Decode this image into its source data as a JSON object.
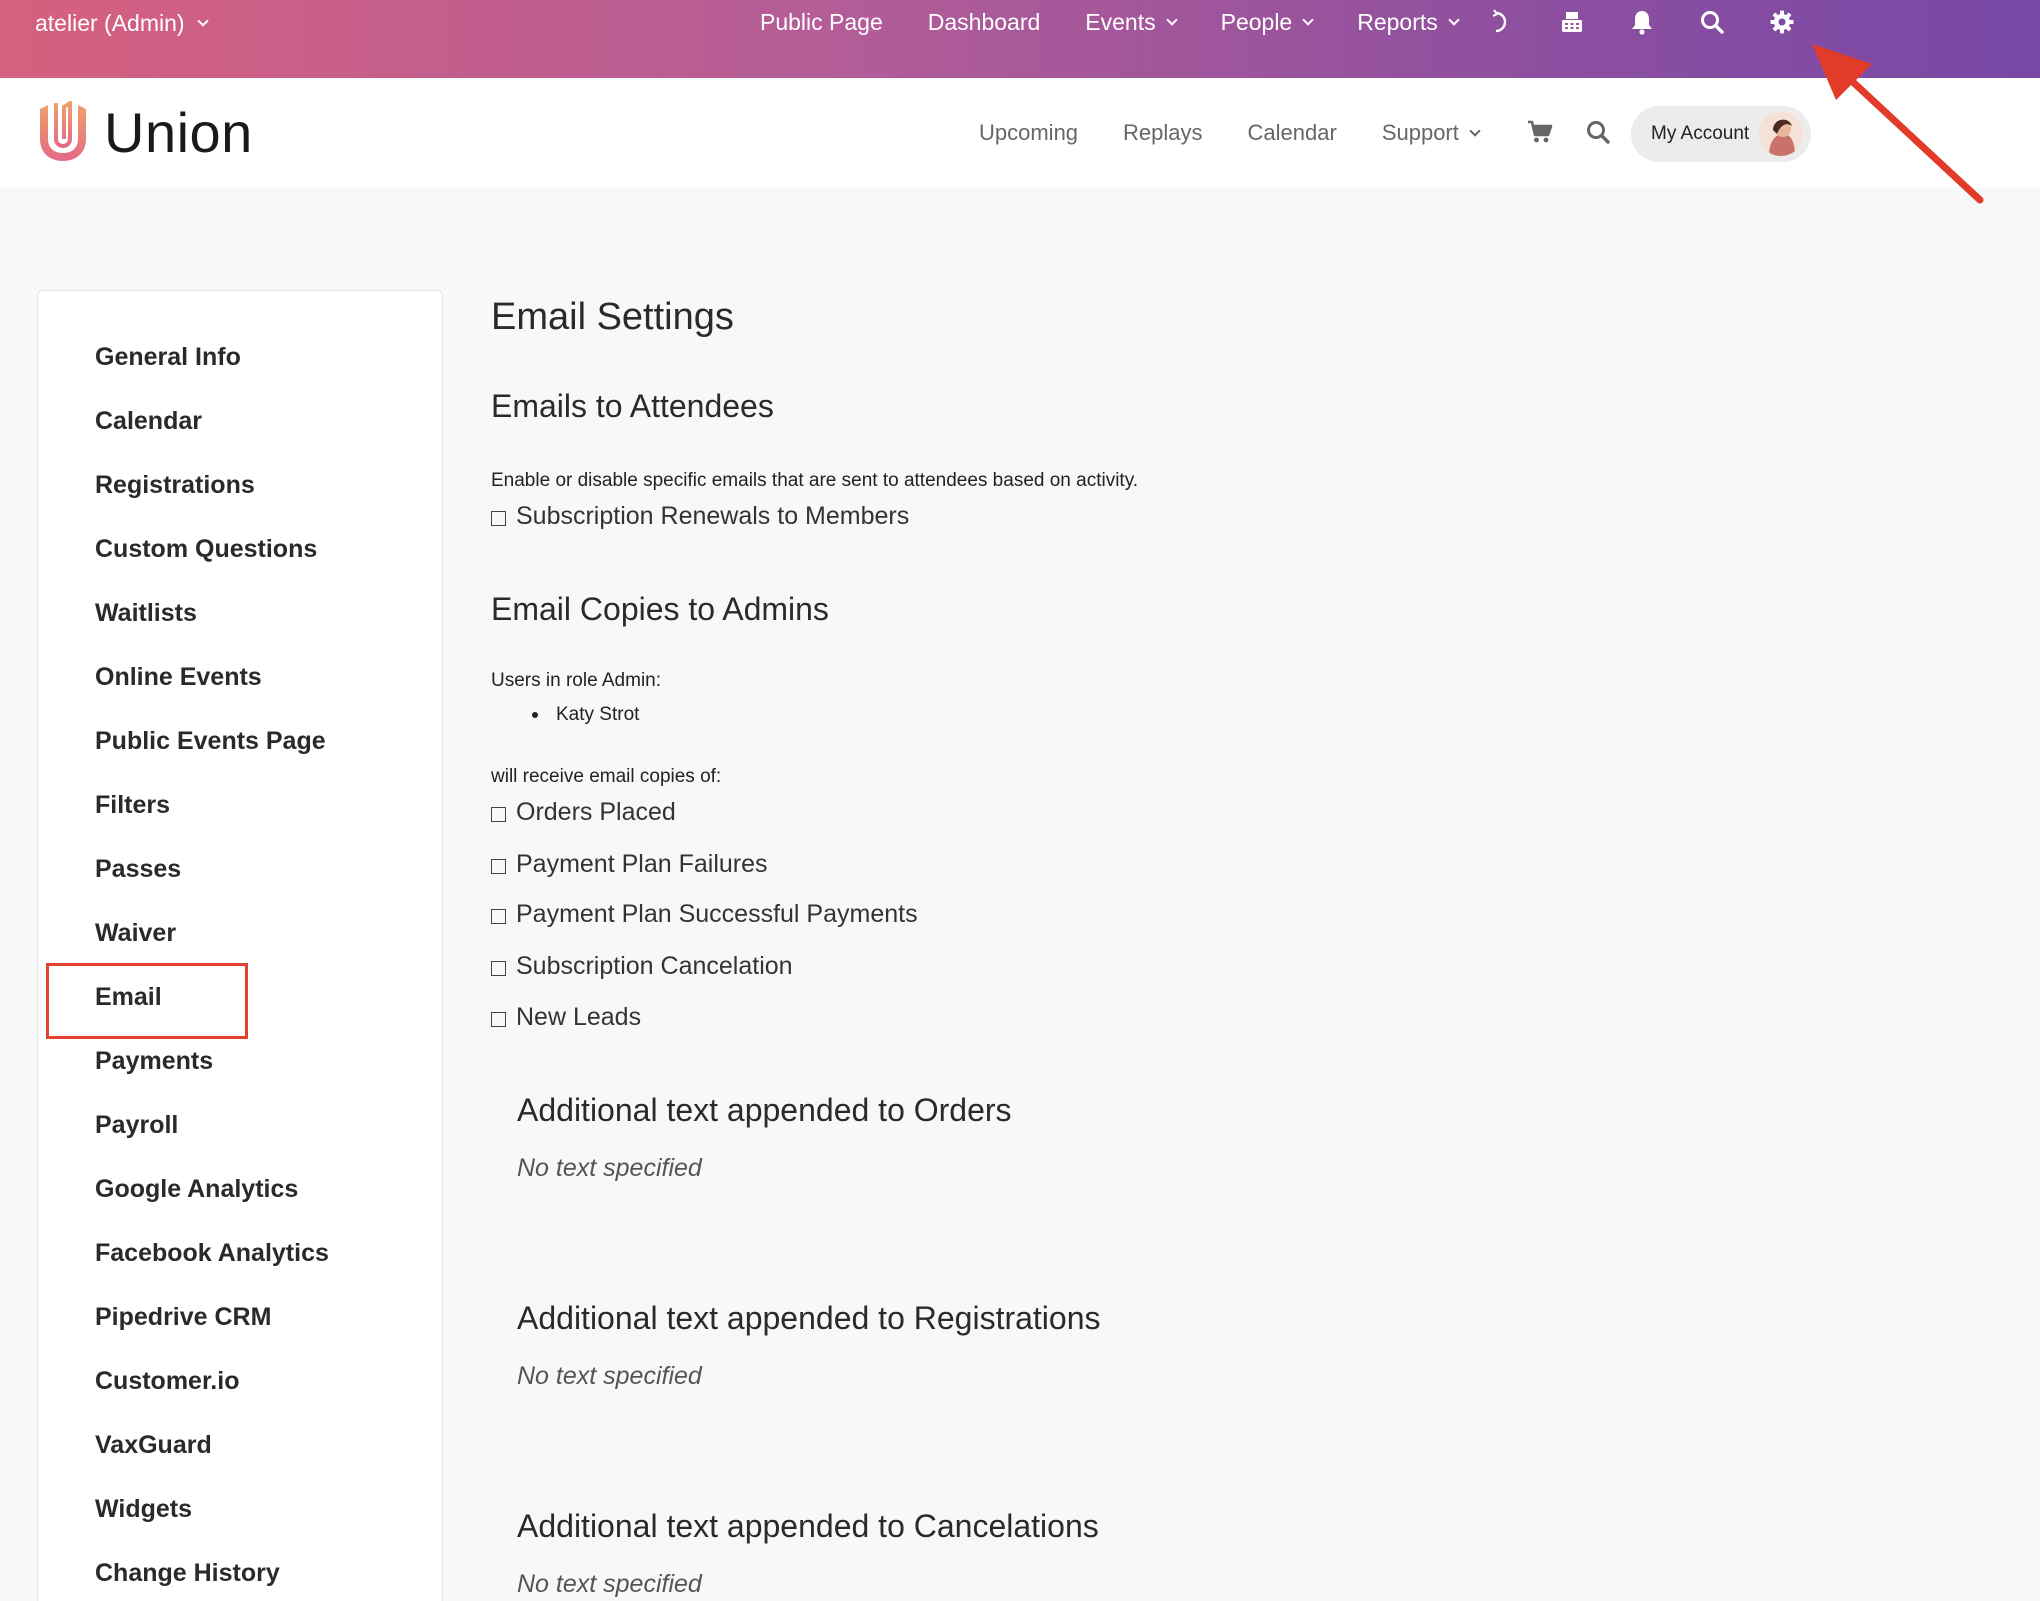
{
  "admin_bar": {
    "org_label": "atelier (Admin)",
    "nav": [
      "Public Page",
      "Dashboard",
      "Events",
      "People",
      "Reports"
    ],
    "nav_dropdown": [
      false,
      false,
      true,
      true,
      true
    ]
  },
  "site_header": {
    "brand": "Union",
    "nav": [
      "Upcoming",
      "Replays",
      "Calendar",
      "Support"
    ],
    "account_label": "My Account"
  },
  "sidebar": {
    "items": [
      "General Info",
      "Calendar",
      "Registrations",
      "Custom Questions",
      "Waitlists",
      "Online Events",
      "Public Events Page",
      "Filters",
      "Passes",
      "Waiver",
      "Email",
      "Payments",
      "Payroll",
      "Google Analytics",
      "Facebook Analytics",
      "Pipedrive CRM",
      "Customer.io",
      "VaxGuard",
      "Widgets",
      "Change History"
    ],
    "active": "Email"
  },
  "main": {
    "title": "Email Settings",
    "attendees": {
      "heading": "Emails to Attendees",
      "description": "Enable or disable specific emails that are sent to attendees based on activity.",
      "options": [
        "Subscription Renewals to Members"
      ]
    },
    "admins": {
      "heading": "Email Copies to Admins",
      "role_text": "Users in role Admin:",
      "users": [
        "Katy Strot"
      ],
      "receive_text": "will receive email copies of:",
      "options": [
        "Orders Placed",
        "Payment Plan Failures",
        "Payment Plan Successful Payments",
        "Subscription Cancelation",
        "New Leads"
      ]
    },
    "appended": [
      {
        "heading": "Additional text appended to Orders",
        "value": "No text specified"
      },
      {
        "heading": "Additional text appended to Registrations",
        "value": "No text specified"
      },
      {
        "heading": "Additional text appended to Cancelations",
        "value": "No text specified"
      }
    ]
  },
  "colors": {
    "admin_gradient_start": "#d6607f",
    "admin_gradient_end": "#7848a6",
    "highlight": "#e1412f"
  }
}
